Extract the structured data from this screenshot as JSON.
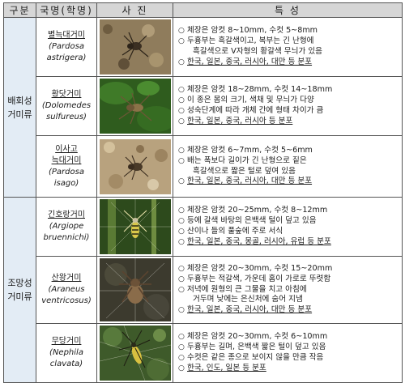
{
  "headers": {
    "group": "구분",
    "name": "국명(학명)",
    "photo": "사 진",
    "traits": "특 성"
  },
  "groups": [
    {
      "label": "배회성\n거미류"
    },
    {
      "label": "조망성\n거미류"
    }
  ],
  "rows": [
    {
      "korean_name": "별늑대거미",
      "scientific_name": "(Pardosa\nastrigera)",
      "traits": [
        {
          "text": "체장은 암컷 8~10mm, 수컷 5~8mm",
          "bullet": true
        },
        {
          "text": "두흉부는 흑갈색이고, 복부는 긴 난형에",
          "bullet": true
        },
        {
          "text": "흑갈색으로 V자형의 황갈색 무늬가 있음",
          "bullet": false
        },
        {
          "text": "한국, 일본, 중국, 러시아, 대만 등 분포",
          "bullet": true,
          "underline": true
        }
      ]
    },
    {
      "korean_name": "황닷거미",
      "scientific_name": "(Dolomedes\nsulfureus)",
      "traits": [
        {
          "text": "체장은 암컷 18~28mm, 수컷 14~18mm",
          "bullet": true
        },
        {
          "text": "이 종은 몸의 크기, 색채 및 무늬가 다양",
          "bullet": true
        },
        {
          "text": "성숙단계에 따라 개체 간에 형태 차이가 큼",
          "bullet": true
        },
        {
          "text": "한국, 일본, 중국, 러시아 등 분포",
          "bullet": true,
          "underline": true
        }
      ]
    },
    {
      "korean_name": "이사고\n늑대거미",
      "scientific_name": "(Pardosa\nisago)",
      "traits": [
        {
          "text": "체장은 암컷 6~7mm, 수컷 5~6mm",
          "bullet": true
        },
        {
          "text": "배는 폭보다 길이가 긴 난형으로 짙은",
          "bullet": true
        },
        {
          "text": "흑갈색으로 짧은 털로 덮여 있음",
          "bullet": false
        },
        {
          "text": "한국, 일본, 중국, 러시아, 대만 등 분포",
          "bullet": true,
          "underline": true
        }
      ]
    },
    {
      "korean_name": "긴호랑거미",
      "scientific_name": "(Argiope\nbruennichi)",
      "traits": [
        {
          "text": "체장은 암컷 20~25mm, 수컷 8~12mm",
          "bullet": true
        },
        {
          "text": "등에 갈색 바탕의 은백색 털이 덮고 있음",
          "bullet": true
        },
        {
          "text": "산이나 들의 풀숲에 주로 서식",
          "bullet": true
        },
        {
          "text": "한국, 일본, 중국, 몽골, 러시아, 유럽 등 분포",
          "bullet": true,
          "underline": true
        }
      ]
    },
    {
      "korean_name": "산왕거미",
      "scientific_name": "(Araneus\nventricosus)",
      "traits": [
        {
          "text": "체장은 암컷 20~30mm, 수컷 15~20mm",
          "bullet": true
        },
        {
          "text": "두흉부는 적갈색, 가운데 홈이 가로로 뚜렷함",
          "bullet": true
        },
        {
          "text": "저녁에 원형의 큰 그물을 치고 아침에",
          "bullet": true
        },
        {
          "text": "거두며 낮에는 은신처에 숨어 지냄",
          "bullet": false
        },
        {
          "text": "한국, 일본, 중국, 러시아, 대만 등 분포",
          "bullet": true,
          "underline": true
        }
      ]
    },
    {
      "korean_name": "무당거미",
      "scientific_name": "(Nephila\nclavata)",
      "traits": [
        {
          "text": "체장은 암컷 20~30mm, 수컷 6~10mm",
          "bullet": true
        },
        {
          "text": "두흉부는 길며, 은백색 짧은 털이 덮고 있음",
          "bullet": true
        },
        {
          "text": "수컷은 같은 종으로 보이지 않을 만큼 작음",
          "bullet": true
        },
        {
          "text": "한국, 인도, 일본 등 분포",
          "bullet": true,
          "underline": true
        }
      ]
    }
  ]
}
